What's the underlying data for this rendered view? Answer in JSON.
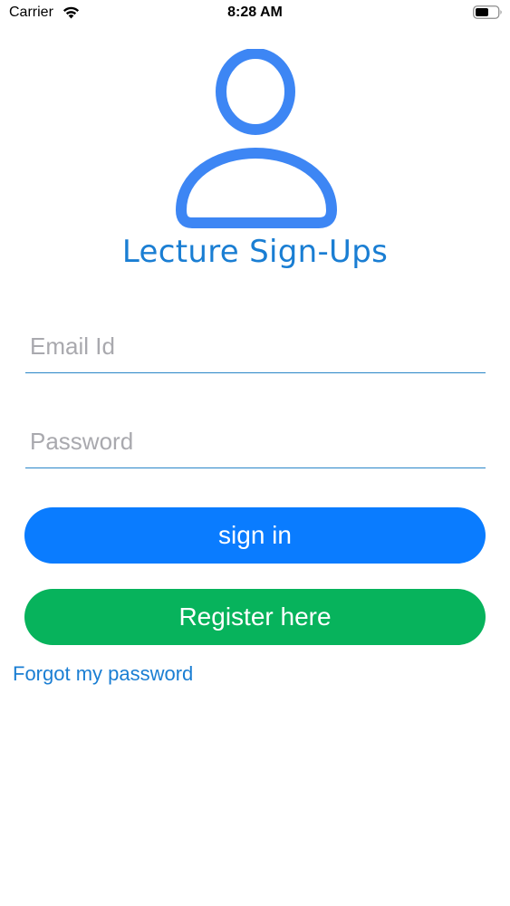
{
  "status_bar": {
    "carrier": "Carrier",
    "time": "8:28 AM",
    "wifi_icon": "wifi-icon",
    "battery_icon": "battery-icon"
  },
  "logo": {
    "icon": "person-icon",
    "title": "Lecture Sign-Ups",
    "color": "#1a7ed3",
    "icon_color": "#3d86f4"
  },
  "form": {
    "email": {
      "value": "",
      "placeholder": "Email Id"
    },
    "password": {
      "value": "",
      "placeholder": "Password"
    },
    "signin_label": "sign in",
    "register_label": "Register here",
    "forgot_label": "Forgot my password"
  },
  "colors": {
    "primary_blue": "#0a7cff",
    "register_green": "#07b35c",
    "link_blue": "#1a7ed3",
    "field_underline": "#2a86c8"
  }
}
